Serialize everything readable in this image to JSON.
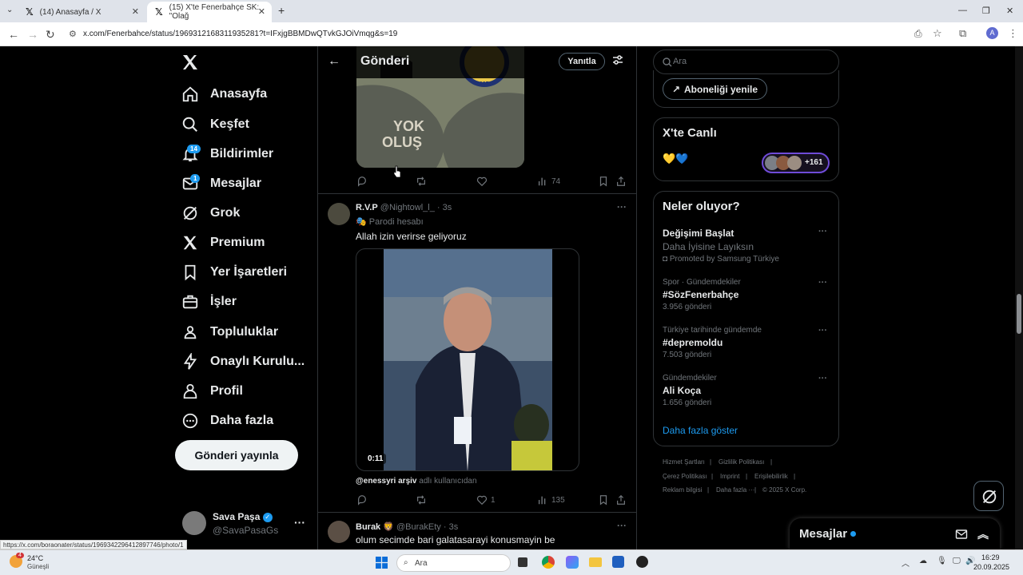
{
  "browser": {
    "tabs": [
      {
        "title": "(14) Anasayfa / X"
      },
      {
        "title": "(15) X'te Fenerbahçe SK: \"Olağ"
      }
    ],
    "url": "x.com/Fenerbahce/status/1969312168311935281?t=IFxjgBBMDwQTvkGJOiVmqg&s=19",
    "status_url": "https://x.com/boraonater/status/1969342296412897746/photo/1",
    "profile_initial": "A"
  },
  "sidebar": {
    "items": [
      {
        "label": "Anasayfa",
        "icon": "home-icon"
      },
      {
        "label": "Keşfet",
        "icon": "search-icon"
      },
      {
        "label": "Bildirimler",
        "icon": "bell-icon",
        "badge": "14"
      },
      {
        "label": "Mesajlar",
        "icon": "mail-icon",
        "badge": "1"
      },
      {
        "label": "Grok",
        "icon": "grok-icon"
      },
      {
        "label": "Premium",
        "icon": "x-icon"
      },
      {
        "label": "Yer İşaretleri",
        "icon": "bookmark-icon"
      },
      {
        "label": "İşler",
        "icon": "briefcase-icon"
      },
      {
        "label": "Topluluklar",
        "icon": "people-icon"
      },
      {
        "label": "Onaylı Kurulu...",
        "icon": "lightning-icon"
      },
      {
        "label": "Profil",
        "icon": "person-icon"
      },
      {
        "label": "Daha fazla",
        "icon": "more-circle-icon"
      }
    ],
    "post_button": "Gönderi yayınla",
    "account": {
      "name": "Sava Paşa",
      "handle": "@SavaPasaGs"
    }
  },
  "main": {
    "title": "Gönderi",
    "reply_button": "Yanıtla",
    "image_text_top": "YOK",
    "image_text_bottom": "OLUŞ",
    "image_badge": "1907",
    "first_post_views": "74",
    "post2": {
      "name": "R.V.P",
      "handle": "@Nightowl_l_",
      "time": "· 3s",
      "parody": "Parodi hesabı",
      "text": "Allah izin verirse geliyoruz",
      "video_time": "0:11",
      "attribution_user": "@enessyri arşiv",
      "attribution_suffix": "adlı kullanıcıdan",
      "likes": "1",
      "views": "135"
    },
    "post3": {
      "name": "Burak",
      "emoji": "🦁",
      "handle": "@BurakEty",
      "time": "· 3s",
      "text": "olum secimde bari galatasarayi konusmayin be"
    }
  },
  "right": {
    "search_placeholder": "Ara",
    "renew_button": "Aboneliği yenile",
    "live_title": "X'te Canlı",
    "live_emojis": "💛💙",
    "live_count": "+161",
    "trends_title": "Neler oluyor?",
    "trends": [
      {
        "meta": "",
        "title": "Değişimi Başlat",
        "subtitle": "Daha İyisine Layıksın",
        "extra": "Promoted by Samsung Türkiye"
      },
      {
        "meta": "Spor · Gündemdekiler",
        "title": "#SözFenerbahçe",
        "subtitle": "",
        "extra": "3.956 gönderi"
      },
      {
        "meta": "Türkiye tarihinde gündemde",
        "title": "#depremoldu",
        "subtitle": "",
        "extra": "7.503 gönderi"
      },
      {
        "meta": "Gündemdekiler",
        "title": "Ali Koça",
        "subtitle": "",
        "extra": "1.656 gönderi"
      }
    ],
    "show_more": "Daha fazla göster",
    "footer": [
      "Hizmet Şartları",
      "Gizlilik Politikası",
      "Çerez Politikası",
      "Imprint",
      "Erişilebilirlik",
      "Reklam bilgisi",
      "Daha fazla ···",
      "© 2025 X Corp."
    ],
    "messages_title": "Mesajlar"
  },
  "taskbar": {
    "weather_temp": "24°C",
    "weather_desc": "Güneşli",
    "weather_badge": "4",
    "search": "Ara",
    "time": "16:29",
    "date": "20.09.2025"
  }
}
